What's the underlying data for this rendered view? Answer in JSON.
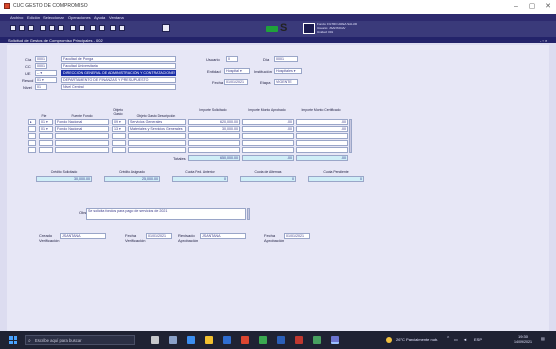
{
  "window": {
    "title": "CUC GESTO DE COMPROMISO",
    "controls": [
      "–",
      "▢",
      "✕"
    ]
  },
  "menu": [
    "Archivo",
    "Edición",
    "Seleccionar",
    "Operaciones",
    "Ayuda",
    "Ventana"
  ],
  "toolbar": {
    "logo_text": [
      "Fondo: FILTRO AREA SALUD",
      "Usuario: JSANTANA/",
      "Unidad: 001"
    ]
  },
  "form": {
    "header_title": "Solicitud de Gestos de Compromiso Principales - 002",
    "header_ctl": "- ▫ ×",
    "rows": {
      "cia_label": "Cía",
      "cia_code": "0001",
      "cia_value": "Facultad de Ponga",
      "cc_label": "CC",
      "cc_code": "0001",
      "cc_value": "Facultad Universitaria",
      "ue_label": "UE",
      "ue_code": "--  ▾",
      "ue_value": "DIRECCIÓN GENERAL DE ADMINISTRACIÓN Y CONTRATACIONES",
      "rescd_label": "Rescd",
      "rescd_code": "01  ▾",
      "rescd_value": "DEPARTAMENTO DE FINANZAS Y PRESUPUESTO",
      "nivel_label": "Nivel",
      "nivel_code": "01",
      "nivel_value": "Nivel Central"
    },
    "right": {
      "usuario_label": "Usuario",
      "usuario_value": "0",
      "dia_label": "Día",
      "dia_value": "0001",
      "entidad_label": "Entidad",
      "entidad_value": "Hospital  ▾",
      "institucion_label": "Institución",
      "institucion_value": "Hospitales  ▾",
      "fecha_label": "Fecha",
      "fecha_value": "01/01/2021",
      "etapa_label": "Etapa",
      "etapa_value": "VIGENTE"
    },
    "table": {
      "headers": [
        "Fte",
        "Fuente Fondo",
        "Objeto Gasto",
        "Objeto Gasto Descripción",
        "Importe Solicitado",
        "Importe Monto Aprobado",
        "Importe Monto Certificado"
      ],
      "rows": [
        {
          "fte": "01 ▾",
          "fuente": "Fondo Nacional",
          "obj": "09 ▾",
          "obj_desc": "Servicios Generales",
          "imp1": "620,000.00",
          "imp2": ".00",
          "imp3": ".00"
        },
        {
          "fte": "01 ▾",
          "fuente": "Fondo Nacional",
          "obj": "13 ▾",
          "obj_desc": "Materiales y Servicios Generales",
          "imp1": "30,000.00",
          "imp2": ".00",
          "imp3": ".00"
        },
        {
          "fte": "",
          "fuente": "",
          "obj": "",
          "obj_desc": "",
          "imp1": "",
          "imp2": "",
          "imp3": ""
        },
        {
          "fte": "",
          "fuente": "",
          "obj": "",
          "obj_desc": "",
          "imp1": "",
          "imp2": "",
          "imp3": ""
        },
        {
          "fte": "",
          "fuente": "",
          "obj": "",
          "obj_desc": "",
          "imp1": "",
          "imp2": "",
          "imp3": ""
        }
      ],
      "totals_label": "Totales",
      "totals": [
        "650,000.00",
        ".00",
        ".00"
      ]
    },
    "summary": {
      "labels": [
        "Crédito Solicitado",
        "Crédito Asignado",
        "Cuota Fed. Anterior",
        "Cuota de Alternas",
        "Cuota Pendiente"
      ],
      "values": [
        "30,000.00",
        "25,000.00",
        "0",
        "0",
        "0"
      ]
    },
    "observ": {
      "label": "Obs.",
      "value": "Se solicita fondos para pago de servicios de 2021"
    },
    "footer": {
      "creado_label": "Creado",
      "creado_sub": "Verificación",
      "creado_value": "JSANTANA",
      "fecha1_label": "Fecha",
      "fecha1_sub": "Verificación",
      "fecha1_value": "01/01/2021",
      "revisado_label": "Revisado",
      "revisado_sub": "Aprobación",
      "revisado_value": "JSANTANA",
      "fecha2_label": "Fecha",
      "fecha2_sub": "Aprobación",
      "fecha2_value": "01/01/2021"
    }
  },
  "taskbar": {
    "search_placeholder": "Escribe aquí para buscar",
    "weather": "26°C  Parcialmente nub.",
    "tray_lang": "ESP",
    "time": "19:30",
    "date": "14/09/2021"
  },
  "colors": {
    "menubar": "#2d2a6e",
    "toolbar": "#3a3a7a",
    "selection": "#1a2ea8",
    "field_cyan": "#cfeef7",
    "canvas": "#dcdcf0"
  }
}
